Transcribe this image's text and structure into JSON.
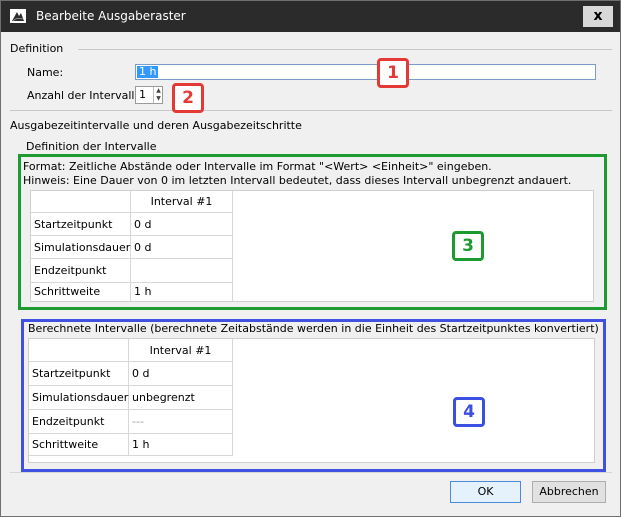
{
  "window": {
    "title": "Bearbeite Ausgaberaster",
    "close_glyph": "x"
  },
  "definition": {
    "section_label": "Definition",
    "name_label": "Name:",
    "name_value": "1 h",
    "intervals_label": "Anzahl der Intervalle:",
    "intervals_value": "1"
  },
  "output_section_label": "Ausgabezeitintervalle und deren Ausgabezeitschritte",
  "interval_definition": {
    "label": "Definition der Intervalle",
    "format_hint": "Format: Zeitliche Abstände oder Intervalle im Format \"<Wert> <Einheit>\" eingeben.",
    "duration_hint": "Hinweis: Eine Dauer von 0 im letzten Intervall bedeutet, dass dieses Intervall unbegrenzt andauert.",
    "column_header": "Interval #1",
    "rows": [
      {
        "label": "Startzeitpunkt",
        "value": "0 d"
      },
      {
        "label": "Simulationsdauer",
        "value": "0 d"
      },
      {
        "label": "Endzeitpunkt",
        "value": ""
      },
      {
        "label": "Schrittweite",
        "value": "1 h"
      }
    ]
  },
  "computed_intervals": {
    "label": "Berechnete Intervalle (berechnete Zeitabstände werden in die Einheit des Startzeitpunktes konvertiert)",
    "column_header": "Interval #1",
    "rows": [
      {
        "label": "Startzeitpunkt",
        "value": "0 d"
      },
      {
        "label": "Simulationsdauer",
        "value": "unbegrenzt"
      },
      {
        "label": "Endzeitpunkt",
        "value": "---"
      },
      {
        "label": "Schrittweite",
        "value": "1 h"
      }
    ]
  },
  "badges": [
    "1",
    "2",
    "3",
    "4"
  ],
  "buttons": {
    "ok": "OK",
    "cancel": "Abbrechen"
  },
  "colors": {
    "badge_red": "#e53935",
    "badge_green": "#1e9b30",
    "badge_blue": "#3d4fe0",
    "titlebar": "#2b2b2b"
  }
}
